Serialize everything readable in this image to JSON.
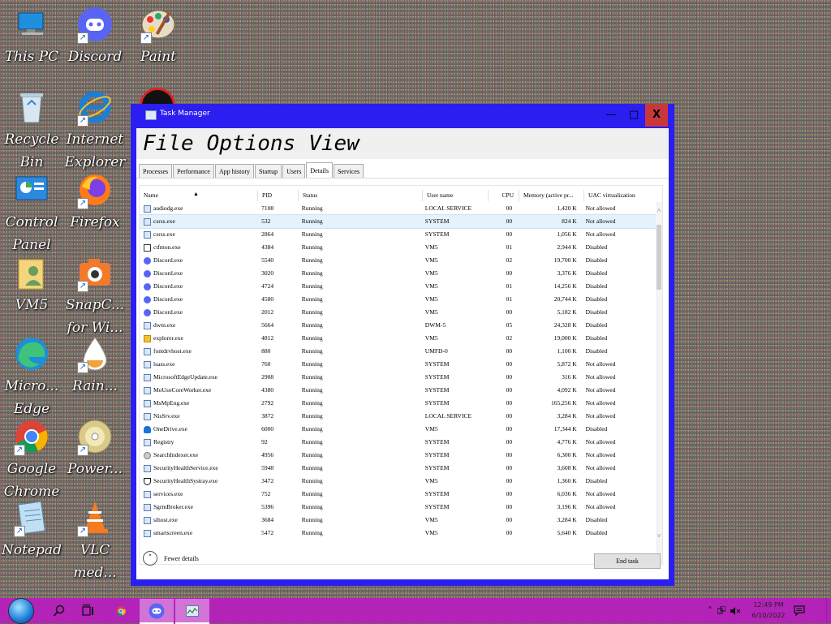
{
  "desktop": {
    "icons": [
      {
        "label": "This PC"
      },
      {
        "label": "Discord"
      },
      {
        "label": "Paint"
      },
      {
        "label": "Recycle\nBin"
      },
      {
        "label": "Internet\nExplorer"
      },
      {
        "label": "Control\nPanel"
      },
      {
        "label": "Firefox"
      },
      {
        "label": "VM5"
      },
      {
        "label": "SnapC...\nfor Wi..."
      },
      {
        "label": "Micro...\nEdge"
      },
      {
        "label": "Rain..."
      },
      {
        "label": "Google\nChrome"
      },
      {
        "label": "Power..."
      },
      {
        "label": "Notepad"
      },
      {
        "label": "VLC\nmed..."
      }
    ]
  },
  "window": {
    "title": "Task Manager",
    "controls": {
      "minimize": "—",
      "maximize": "□",
      "close": "X"
    },
    "menu": [
      "File",
      "Options",
      "View"
    ],
    "tabs": [
      "Processes",
      "Performance",
      "App history",
      "Startup",
      "Users",
      "Details",
      "Services"
    ],
    "active_tab": "Details",
    "columns": [
      "Name",
      "PID",
      "Status",
      "User name",
      "CPU",
      "Memory (active pr...",
      "UAC virtualization"
    ],
    "sort_indicator": "▲",
    "rows": [
      {
        "name": "audiodg.exe",
        "pid": "7108",
        "status": "Running",
        "user": "LOCAL SERVICE",
        "cpu": "00",
        "mem": "1,420 K",
        "uac": "Not allowed",
        "icon": "app"
      },
      {
        "name": "csrss.exe",
        "pid": "532",
        "status": "Running",
        "user": "SYSTEM",
        "cpu": "00",
        "mem": "824 K",
        "uac": "Not allowed",
        "icon": "app"
      },
      {
        "name": "csrss.exe",
        "pid": "2864",
        "status": "Running",
        "user": "SYSTEM",
        "cpu": "00",
        "mem": "1,056 K",
        "uac": "Not allowed",
        "icon": "app"
      },
      {
        "name": "ctfmon.exe",
        "pid": "4384",
        "status": "Running",
        "user": "VM5",
        "cpu": "01",
        "mem": "2,944 K",
        "uac": "Disabled",
        "icon": "ctf"
      },
      {
        "name": "Discord.exe",
        "pid": "5540",
        "status": "Running",
        "user": "VM5",
        "cpu": "02",
        "mem": "19,700 K",
        "uac": "Disabled",
        "icon": "discord"
      },
      {
        "name": "Discord.exe",
        "pid": "3020",
        "status": "Running",
        "user": "VM5",
        "cpu": "00",
        "mem": "3,376 K",
        "uac": "Disabled",
        "icon": "discord"
      },
      {
        "name": "Discord.exe",
        "pid": "4724",
        "status": "Running",
        "user": "VM5",
        "cpu": "01",
        "mem": "14,256 K",
        "uac": "Disabled",
        "icon": "discord"
      },
      {
        "name": "Discord.exe",
        "pid": "4580",
        "status": "Running",
        "user": "VM5",
        "cpu": "01",
        "mem": "20,744 K",
        "uac": "Disabled",
        "icon": "discord"
      },
      {
        "name": "Discord.exe",
        "pid": "2012",
        "status": "Running",
        "user": "VM5",
        "cpu": "00",
        "mem": "5,182 K",
        "uac": "Disabled",
        "icon": "discord"
      },
      {
        "name": "dwm.exe",
        "pid": "5664",
        "status": "Running",
        "user": "DWM-5",
        "cpu": "05",
        "mem": "24,328 K",
        "uac": "Disabled",
        "icon": "app"
      },
      {
        "name": "explorer.exe",
        "pid": "4812",
        "status": "Running",
        "user": "VM5",
        "cpu": "02",
        "mem": "19,000 K",
        "uac": "Disabled",
        "icon": "explorer"
      },
      {
        "name": "fontdrvhost.exe",
        "pid": "880",
        "status": "Running",
        "user": "UMFD-0",
        "cpu": "00",
        "mem": "1,100 K",
        "uac": "Disabled",
        "icon": "app"
      },
      {
        "name": "lsass.exe",
        "pid": "760",
        "status": "Running",
        "user": "SYSTEM",
        "cpu": "00",
        "mem": "5,872 K",
        "uac": "Not allowed",
        "icon": "app"
      },
      {
        "name": "MicrosoftEdgeUpdate.exe",
        "pid": "2908",
        "status": "Running",
        "user": "SYSTEM",
        "cpu": "00",
        "mem": "316 K",
        "uac": "Not allowed",
        "icon": "app"
      },
      {
        "name": "MoUsoCoreWorker.exe",
        "pid": "4380",
        "status": "Running",
        "user": "SYSTEM",
        "cpu": "00",
        "mem": "4,092 K",
        "uac": "Not allowed",
        "icon": "app"
      },
      {
        "name": "MsMpEng.exe",
        "pid": "2792",
        "status": "Running",
        "user": "SYSTEM",
        "cpu": "00",
        "mem": "165,256 K",
        "uac": "Not allowed",
        "icon": "app"
      },
      {
        "name": "NisSrv.exe",
        "pid": "3872",
        "status": "Running",
        "user": "LOCAL SERVICE",
        "cpu": "00",
        "mem": "3,284 K",
        "uac": "Not allowed",
        "icon": "app"
      },
      {
        "name": "OneDrive.exe",
        "pid": "6000",
        "status": "Running",
        "user": "VM5",
        "cpu": "00",
        "mem": "17,344 K",
        "uac": "Disabled",
        "icon": "onedrive"
      },
      {
        "name": "Registry",
        "pid": "92",
        "status": "Running",
        "user": "SYSTEM",
        "cpu": "00",
        "mem": "4,776 K",
        "uac": "Not allowed",
        "icon": "app"
      },
      {
        "name": "SearchIndexer.exe",
        "pid": "4956",
        "status": "Running",
        "user": "SYSTEM",
        "cpu": "00",
        "mem": "6,300 K",
        "uac": "Not allowed",
        "icon": "search"
      },
      {
        "name": "SecurityHealthService.exe",
        "pid": "5948",
        "status": "Running",
        "user": "SYSTEM",
        "cpu": "00",
        "mem": "3,608 K",
        "uac": "Not allowed",
        "icon": "app"
      },
      {
        "name": "SecurityHealthSystray.exe",
        "pid": "3472",
        "status": "Running",
        "user": "VM5",
        "cpu": "00",
        "mem": "1,360 K",
        "uac": "Disabled",
        "icon": "shield"
      },
      {
        "name": "services.exe",
        "pid": "752",
        "status": "Running",
        "user": "SYSTEM",
        "cpu": "00",
        "mem": "6,036 K",
        "uac": "Not allowed",
        "icon": "app"
      },
      {
        "name": "SgrmBroker.exe",
        "pid": "5396",
        "status": "Running",
        "user": "SYSTEM",
        "cpu": "00",
        "mem": "3,196 K",
        "uac": "Not allowed",
        "icon": "app"
      },
      {
        "name": "sihost.exe",
        "pid": "3684",
        "status": "Running",
        "user": "VM5",
        "cpu": "00",
        "mem": "3,284 K",
        "uac": "Disabled",
        "icon": "app"
      },
      {
        "name": "smartscreen.exe",
        "pid": "5472",
        "status": "Running",
        "user": "VM5",
        "cpu": "00",
        "mem": "5,640 K",
        "uac": "Disabled",
        "icon": "app"
      }
    ],
    "selected_row": 1,
    "fewer_details": "Fewer details",
    "end_task": "End task"
  },
  "taskbar": {
    "clock_time": "12:49 PM",
    "clock_date": "6/10/2022"
  },
  "colors": {
    "window_frame": "#2b1ef0",
    "taskbar": "#b323b8",
    "close_button": "#c8383a"
  }
}
